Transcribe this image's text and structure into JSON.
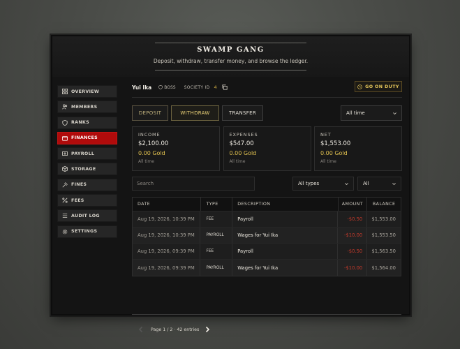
{
  "header": {
    "title": "SWAMP GANG",
    "subtitle": "Deposit, withdraw, transfer money, and browse the ledger."
  },
  "sidebar": {
    "items": [
      {
        "label": "OVERVIEW",
        "icon": "grid-icon"
      },
      {
        "label": "MEMBERS",
        "icon": "users-icon"
      },
      {
        "label": "RANKS",
        "icon": "shield-icon"
      },
      {
        "label": "FINANCES",
        "icon": "wallet-icon",
        "active": true
      },
      {
        "label": "PAYROLL",
        "icon": "banknote-icon"
      },
      {
        "label": "STORAGE",
        "icon": "box-icon"
      },
      {
        "label": "FINES",
        "icon": "gavel-icon"
      },
      {
        "label": "FEES",
        "icon": "percent-icon"
      },
      {
        "label": "AUDIT LOG",
        "icon": "list-icon"
      },
      {
        "label": "SETTINGS",
        "icon": "gear-icon"
      }
    ]
  },
  "topbar": {
    "user": "Yui Ika",
    "role": "BOSS",
    "society_label": "SOCIETY ID",
    "society_id": "4",
    "duty_button": "GO ON DUTY"
  },
  "tabs": {
    "deposit": "DEPOSIT",
    "withdraw": "WITHDRAW",
    "transfer": "TRANSFER",
    "range": "All time"
  },
  "stats": [
    {
      "label": "INCOME",
      "value": "$2,100.00",
      "gold": "0.00 Gold",
      "sub": "All time"
    },
    {
      "label": "EXPENSES",
      "value": "$547.00",
      "gold": "0.00 Gold",
      "sub": "All time"
    },
    {
      "label": "NET",
      "value": "$1,553.00",
      "gold": "0.00 Gold",
      "sub": "All time"
    }
  ],
  "filters": {
    "search_placeholder": "Search",
    "types": "All types",
    "all": "All"
  },
  "table": {
    "headers": {
      "date": "DATE",
      "type": "TYPE",
      "description": "DESCRIPTION",
      "amount": "AMOUNT",
      "balance": "BALANCE"
    },
    "rows": [
      {
        "date": "Aug 19, 2026, 10:39 PM",
        "type": "FEE",
        "description": "Payroll",
        "amount": "-$0.50",
        "balance": "$1,553.00"
      },
      {
        "date": "Aug 19, 2026, 10:39 PM",
        "type": "PAYROLL",
        "description": "Wages for Yui Ika",
        "amount": "-$10.00",
        "balance": "$1,553.50"
      },
      {
        "date": "Aug 19, 2026, 09:39 PM",
        "type": "FEE",
        "description": "Payroll",
        "amount": "-$0.50",
        "balance": "$1,563.50"
      },
      {
        "date": "Aug 19, 2026, 09:39 PM",
        "type": "PAYROLL",
        "description": "Wages for Yui Ika",
        "amount": "-$10.00",
        "balance": "$1,564.00"
      }
    ]
  },
  "pager": {
    "info": "Page 1 / 2 · 42 entries"
  }
}
